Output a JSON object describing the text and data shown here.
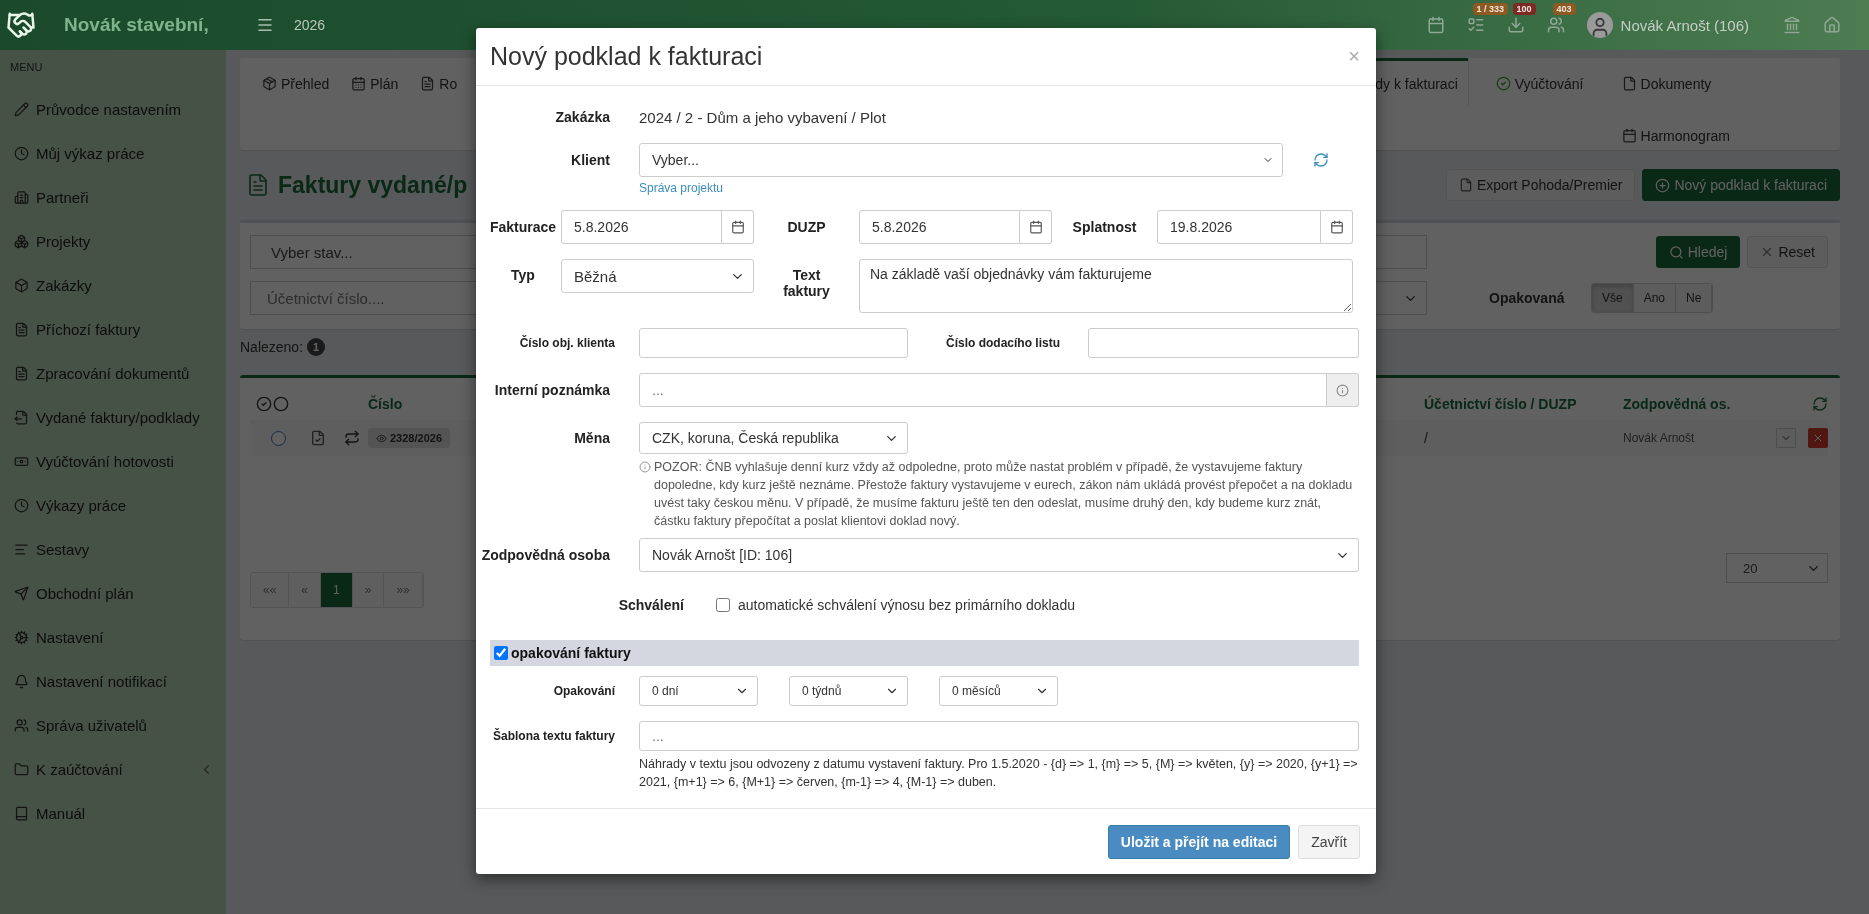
{
  "topbar": {
    "brand": "Novák stavební,",
    "year": "2026",
    "badges": [
      {
        "text": "1 / 333",
        "color": "#8c5a22"
      },
      {
        "text": "100",
        "color": "#7d2a25"
      },
      {
        "text": "403",
        "color": "#8c5a22"
      }
    ],
    "user": "Novák Arnošt (106)"
  },
  "sidebar": {
    "heading": "MENU",
    "items": [
      {
        "label": "Průvodce nastavením",
        "kind": "link"
      },
      {
        "label": "Můj výkaz práce",
        "kind": "link"
      },
      {
        "label": "Partneři",
        "kind": "link"
      },
      {
        "label": "Projekty",
        "kind": "link"
      },
      {
        "label": "Zakázky",
        "kind": "link"
      },
      {
        "label": "Příchozí faktury",
        "kind": "link"
      },
      {
        "label": "Zpracování dokumentů",
        "kind": "link"
      },
      {
        "label": "Vydané faktury/podklady",
        "kind": "link"
      },
      {
        "label": "Vyúčtování hotovosti",
        "kind": "link"
      },
      {
        "label": "Výkazy práce",
        "kind": "link"
      },
      {
        "label": "Sestavy",
        "kind": "link"
      },
      {
        "label": "Obchodní plán",
        "kind": "link"
      },
      {
        "label": "Nastavení",
        "kind": "link"
      },
      {
        "label": "Nastavení notifikací",
        "kind": "link"
      },
      {
        "label": "Správa uživatelů",
        "kind": "link"
      },
      {
        "label": "K zaúčtování",
        "kind": "group"
      },
      {
        "label": "Manuál",
        "kind": "link"
      }
    ]
  },
  "tabs": {
    "left": [
      {
        "label": "Přehled",
        "selected": false
      },
      {
        "label": "Plán",
        "selected": false
      },
      {
        "label": "Ro",
        "selected": false
      }
    ],
    "right": [
      {
        "label": "dy k fakturaci",
        "selected": true
      },
      {
        "label": "Vyúčtování",
        "selected": false
      },
      {
        "label": "Dokumenty",
        "selected": false
      },
      {
        "label": "Harmonogram",
        "selected": false
      }
    ]
  },
  "page": {
    "title": "Faktury vydané/p",
    "buttons": [
      "Export Pohoda/Premier",
      "Nový podklad k fakturaci"
    ]
  },
  "filters": {
    "state_select": "Vyber stav...",
    "accounting_placeholder": "Účetnictví číslo....",
    "search_button": "Hledej",
    "reset_button": "Reset",
    "repeated_label": "Opakovaná",
    "repeated_options": [
      {
        "label": "Vše",
        "selected": true
      },
      {
        "label": "Ano",
        "selected": false
      },
      {
        "label": "Ne",
        "selected": false
      }
    ]
  },
  "results": {
    "label": "Nalezeno:",
    "count": "1"
  },
  "table": {
    "columns_left": [
      "Číslo"
    ],
    "columns_right": [
      "Účetnictví číslo / DUZP",
      "Zodpovědná os."
    ],
    "rows": [
      {
        "selected": false,
        "number": "2328/2026",
        "accounting": "/",
        "responsible": "Novák Arnošt"
      }
    ]
  },
  "pagination": {
    "pages": [
      {
        "label": "««",
        "selected": false
      },
      {
        "label": "«",
        "selected": false
      },
      {
        "label": "1",
        "selected": true
      },
      {
        "label": "»",
        "selected": false
      },
      {
        "label": "»»",
        "selected": false
      }
    ],
    "page_size": "20"
  },
  "modal": {
    "title": "Nový podklad k fakturaci",
    "close": "×",
    "order_label": "Zakázka",
    "order_value": "2024 / 2 - Dům a jeho vybavení / Plot",
    "client_label": "Klient",
    "client_value": "Vyber...",
    "project_link": "Správa projektu",
    "dates": [
      {
        "label": "Fakturace",
        "value": "5.8.2026"
      },
      {
        "label": "DUZP",
        "value": "5.8.2026"
      },
      {
        "label": "Splatnost",
        "value": "19.8.2026"
      }
    ],
    "type_label": "Typ",
    "type_value": "Běžná",
    "text_label": "Text faktury",
    "text_value": "Na základě vaší objednávky vám fakturujeme",
    "client_order_label": "Číslo obj. klienta",
    "delivery_note_label": "Číslo dodacího listu",
    "note_label": "Interní poznámka",
    "note_placeholder": "...",
    "currency_label": "Měna",
    "currency_value": "CZK, koruna, Česká republika",
    "currency_warning": "POZOR: ČNB vyhlašuje denní kurz vždy až odpoledne, proto může nastat problém v případě, že vystavujeme faktury dopoledne, kdy kurz ještě neznáme. Přestože faktury vystavujeme v eurech, zákon nám ukládá provést přepočet a na dokladu uvést taky českou měnu. V případě, že musíme fakturu ještě ten den odeslat, musíme druhý den, kdy budeme kurz znát, částku faktury přepočítat a poslat klientovi doklad nový.",
    "responsible_label": "Zodpovědná osoba",
    "responsible_value": "Novák Arnošt [ID: 106]",
    "approval_label": "Schválení",
    "approval_text": "automatické schválení výnosu bez primárního dokladu",
    "approval_checked": false,
    "repeat": {
      "label": "opakování faktury",
      "checked": true,
      "interval_label": "Opakování",
      "intervals": [
        "0 dní",
        "0 týdnů",
        "0 měsíců"
      ],
      "template_label": "Šablona textu faktury",
      "template_placeholder": "...",
      "template_help": "Náhrady v textu jsou odvozeny z datumu vystavení faktury. Pro 1.5.2020 - {d} => 1, {m} => 5, {M} => květen, {y} => 2020, {y+1} => 2021, {m+1} => 6, {M+1} => červen, {m-1} => 4, {M-1} => duben."
    },
    "buttons": [
      {
        "label": "Uložit a přejít na editaci",
        "kind": "primary"
      },
      {
        "label": "Zavřít",
        "kind": "default"
      }
    ]
  }
}
